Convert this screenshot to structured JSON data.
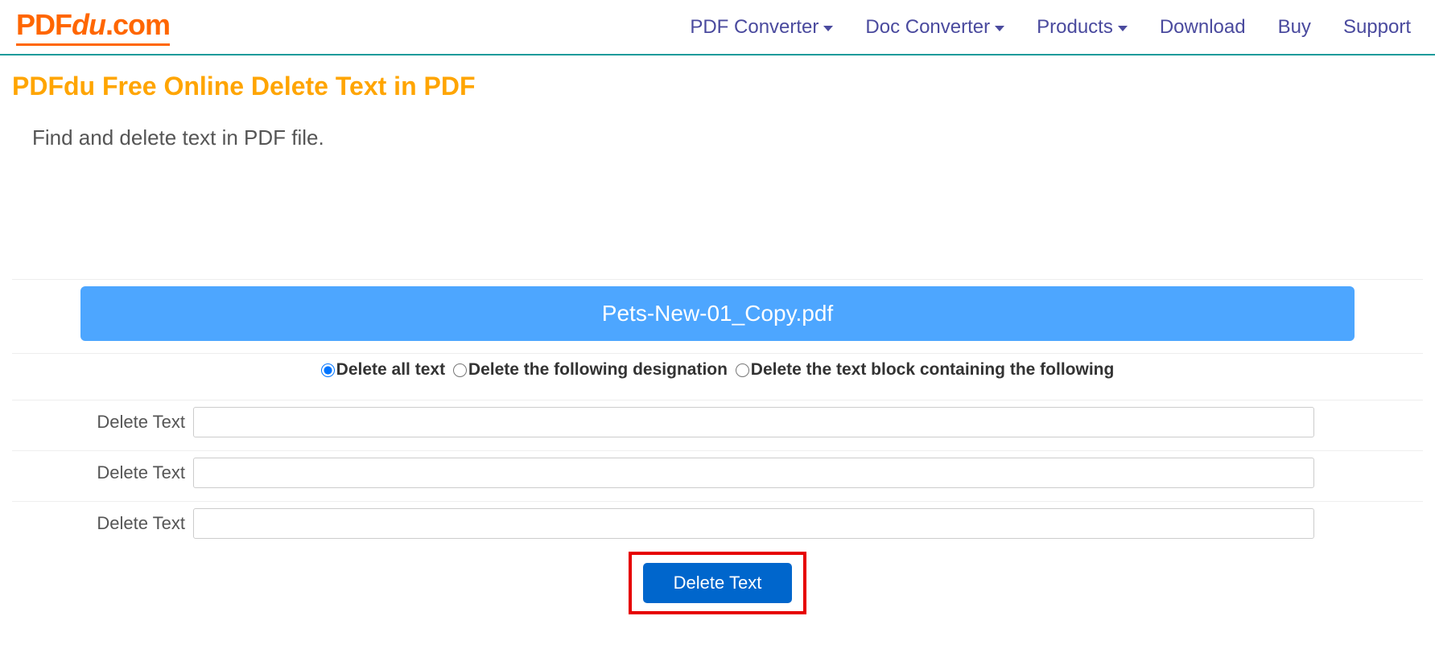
{
  "header": {
    "logo_prefix": "PDF",
    "logo_mid": "du",
    "logo_suffix": ".com",
    "nav": {
      "pdf_converter": "PDF Converter",
      "doc_converter": "Doc Converter",
      "products": "Products",
      "download": "Download",
      "buy": "Buy",
      "support": "Support"
    }
  },
  "page": {
    "title": "PDFdu Free Online Delete Text in PDF",
    "subtitle": "Find and delete text in PDF file."
  },
  "file": {
    "name": "Pets-New-01_Copy.pdf"
  },
  "options": {
    "delete_all": "Delete all text",
    "delete_designation": "Delete the following designation",
    "delete_block": "Delete the text block containing the following"
  },
  "inputs": {
    "label": "Delete Text",
    "value1": "",
    "value2": "",
    "value3": ""
  },
  "button": {
    "delete": "Delete Text"
  }
}
